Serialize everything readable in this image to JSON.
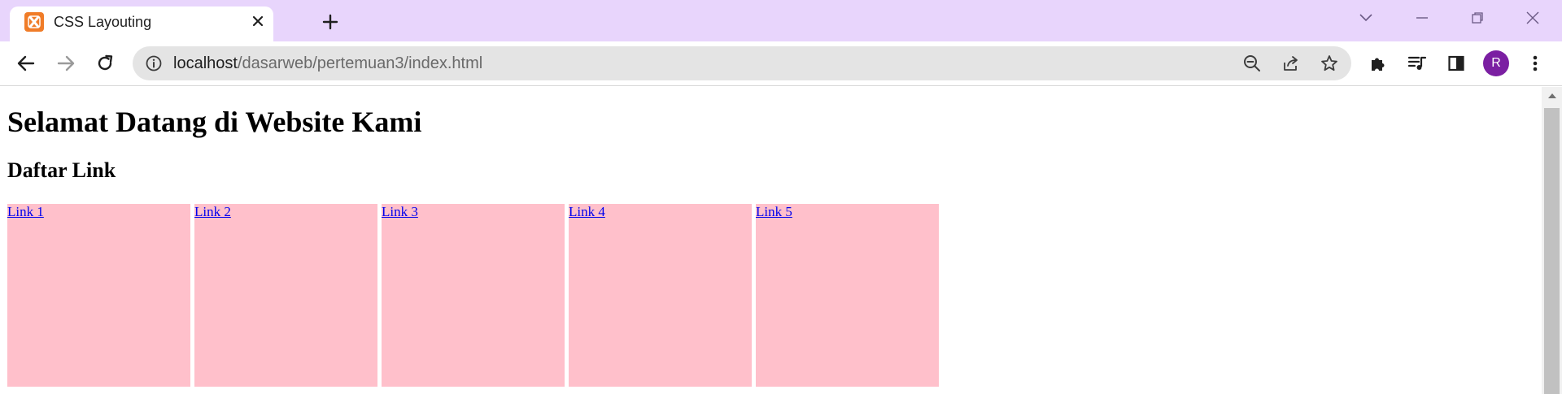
{
  "tab": {
    "title": "CSS Layouting",
    "favicon": "xampp-icon"
  },
  "window": {
    "controls": [
      "tab-search",
      "minimize",
      "restore",
      "close"
    ]
  },
  "toolbar": {
    "url_host": "localhost",
    "url_path": "/dasarweb/pertemuan3/index.html",
    "avatar_letter": "R"
  },
  "page": {
    "heading": "Selamat Datang di Website Kami",
    "subheading": "Daftar Link",
    "links": [
      "Link 1",
      "Link 2",
      "Link 3",
      "Link 4",
      "Link 5"
    ]
  },
  "colors": {
    "tabstrip": "#e8d5fc",
    "link_box": "#ffc0cb",
    "link_text": "#0000ee",
    "avatar": "#7b1fa2"
  }
}
